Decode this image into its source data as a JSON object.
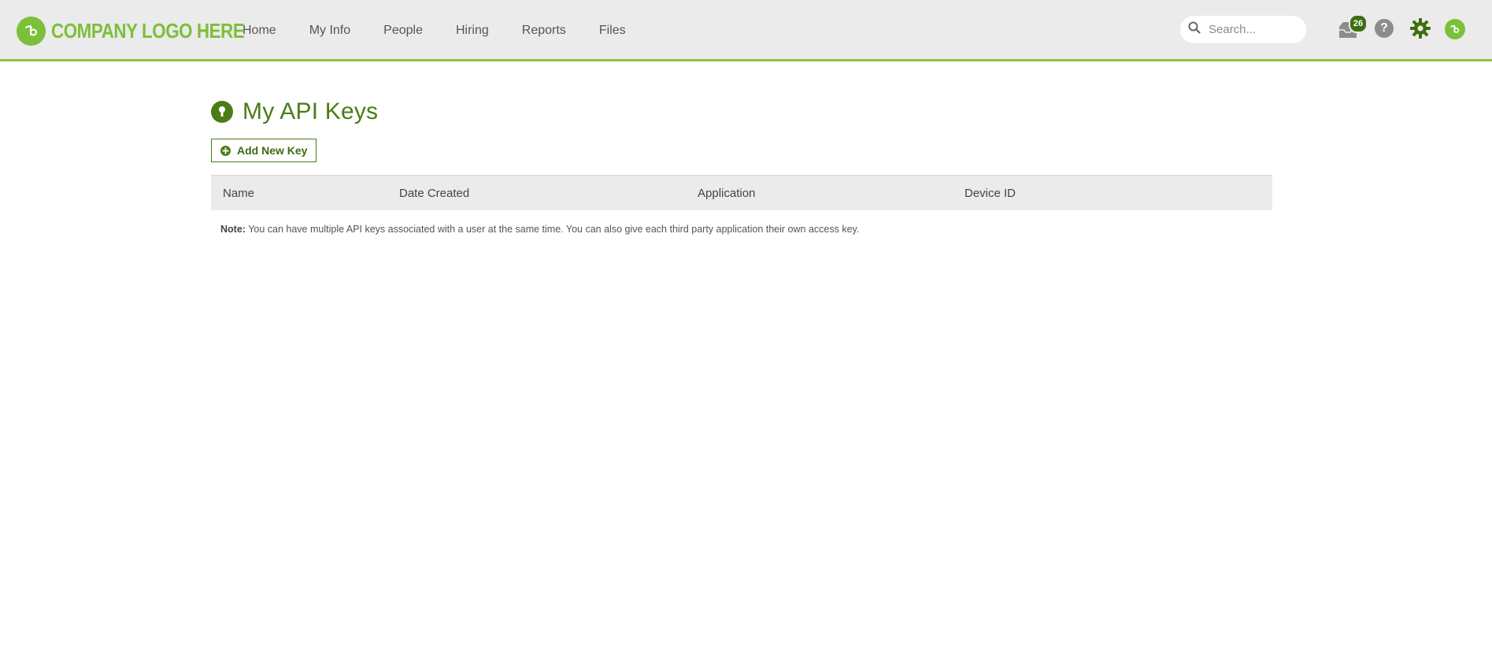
{
  "header": {
    "logo_text": "COMPANY LOGO HERE",
    "nav": [
      {
        "label": "Home"
      },
      {
        "label": "My Info"
      },
      {
        "label": "People"
      },
      {
        "label": "Hiring"
      },
      {
        "label": "Reports"
      },
      {
        "label": "Files"
      }
    ],
    "search": {
      "placeholder": "Search..."
    },
    "inbox_count": "26",
    "icons": [
      "inbox-icon",
      "help-icon",
      "gear-icon",
      "avatar"
    ]
  },
  "page": {
    "title": "My API Keys",
    "add_button_label": "Add New Key",
    "table": {
      "columns": [
        "Name",
        "Date Created",
        "Application",
        "Device ID"
      ]
    },
    "note_label": "Note:",
    "note_text": " You can have multiple API keys associated with a user at the same time. You can also give each third party application their own access key."
  },
  "colors": {
    "brand_green": "#7cbf3a",
    "dark_green": "#4a7d14",
    "header_bg": "#ebebeb"
  }
}
